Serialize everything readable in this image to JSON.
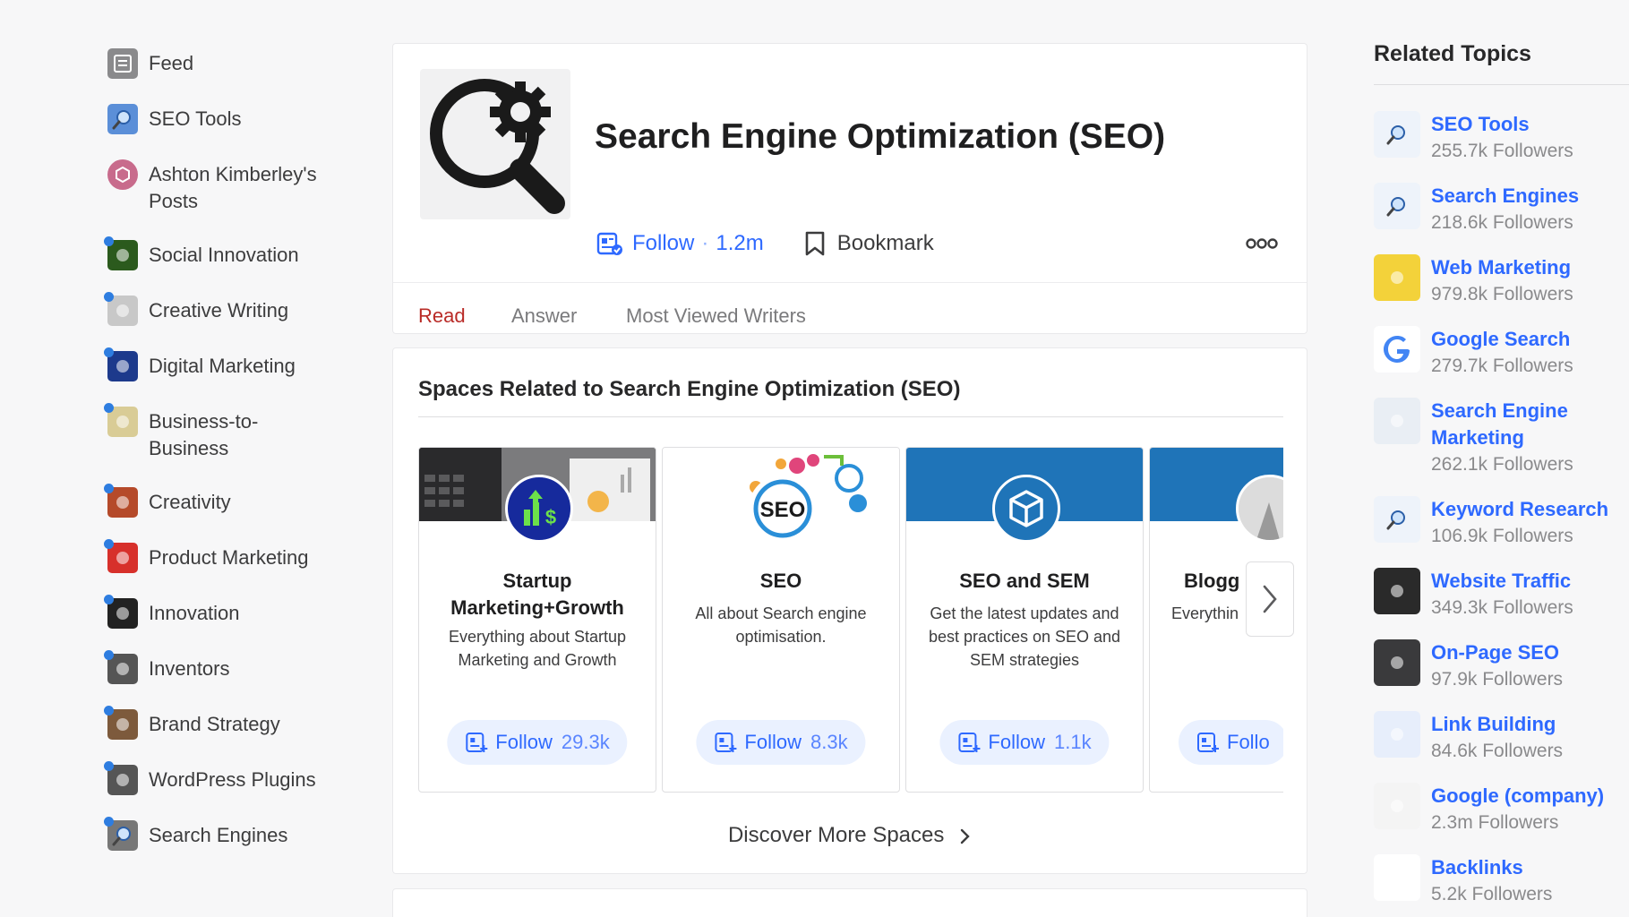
{
  "sidebar": {
    "items": [
      {
        "label": "Feed",
        "icon": "feed-icon",
        "dot": false,
        "color": "#8a8a8c"
      },
      {
        "label": "SEO Tools",
        "icon": "magnifier-icon",
        "dot": false,
        "color": "#5b8fd8"
      },
      {
        "label": "Ashton Kimberley's Posts",
        "icon": "cube-icon",
        "dot": false,
        "color": "#c86b8c"
      },
      {
        "label": "Social Innovation",
        "icon": "bulb-icon",
        "dot": true,
        "color": "#2b5a1d"
      },
      {
        "label": "Creative Writing",
        "icon": "pen-icon",
        "dot": true,
        "color": "#c8c8c8"
      },
      {
        "label": "Digital Marketing",
        "icon": "chart-icon",
        "dot": true,
        "color": "#1d3a8c"
      },
      {
        "label": "Business-to-Business",
        "icon": "handshake-icon",
        "dot": true,
        "color": "#d9cc96"
      },
      {
        "label": "Creativity",
        "icon": "palette-icon",
        "dot": true,
        "color": "#b54a2a"
      },
      {
        "label": "Product Marketing",
        "icon": "new-badge-icon",
        "dot": true,
        "color": "#d7302b"
      },
      {
        "label": "Innovation",
        "icon": "gears-icon",
        "dot": true,
        "color": "#222222"
      },
      {
        "label": "Inventors",
        "icon": "people-icon",
        "dot": true,
        "color": "#555555"
      },
      {
        "label": "Brand Strategy",
        "icon": "owl-icon",
        "dot": true,
        "color": "#7d5a3c"
      },
      {
        "label": "WordPress Plugins",
        "icon": "wordpress-icon",
        "dot": true,
        "color": "#555555"
      },
      {
        "label": "Search Engines",
        "icon": "magnifier-icon",
        "dot": true,
        "color": "#777777"
      }
    ]
  },
  "topic": {
    "title": "Search Engine Optimization (SEO)",
    "follow_label": "Follow",
    "follow_count": "1.2m",
    "bookmark_label": "Bookmark"
  },
  "tabs": [
    {
      "label": "Read",
      "active": true
    },
    {
      "label": "Answer",
      "active": false
    },
    {
      "label": "Most Viewed Writers",
      "active": false
    }
  ],
  "spaces": {
    "title": "Spaces Related to Search Engine Optimization (SEO)",
    "discover_label": "Discover More Spaces",
    "items": [
      {
        "name": "Startup Marketing+Growth",
        "desc": "Everything about Startup Marketing and Growth",
        "follow_label": "Follow",
        "follow_count": "29.3k",
        "banner": "#3a3a3c",
        "logo": "#162a9c"
      },
      {
        "name": "SEO",
        "desc": "All about Search engine optimisation.",
        "follow_label": "Follow",
        "follow_count": "8.3k",
        "banner": "#ffffff",
        "logo": "#ffffff"
      },
      {
        "name": "SEO and SEM",
        "desc": "Get the latest updates and best practices on SEO and SEM strategies",
        "follow_label": "Follow",
        "follow_count": "1.1k",
        "banner": "#1f74b8",
        "logo": "#1f74b8"
      },
      {
        "name": "Blogg",
        "desc": "Everythin",
        "follow_label": "Follo",
        "follow_count": "",
        "banner": "#1f74b8",
        "logo": "#e0e0e0"
      }
    ]
  },
  "related": {
    "title": "Related Topics",
    "items": [
      {
        "name": "SEO Tools",
        "count": "255.7k Followers",
        "icon": "magnifier-icon"
      },
      {
        "name": "Search Engines",
        "count": "218.6k Followers",
        "icon": "magnifier-icon"
      },
      {
        "name": "Web Marketing",
        "count": "979.8k Followers",
        "icon": "success-badge-icon"
      },
      {
        "name": "Google Search",
        "count": "279.7k Followers",
        "icon": "google-icon"
      },
      {
        "name": "Search Engine Marketing",
        "count": "262.1k Followers",
        "icon": "browser-search-icon"
      },
      {
        "name": "Keyword Research",
        "count": "106.9k Followers",
        "icon": "magnifier-icon"
      },
      {
        "name": "Website Traffic",
        "count": "349.3k Followers",
        "icon": "traffic-light-icon"
      },
      {
        "name": "On-Page SEO",
        "count": "97.9k Followers",
        "icon": "phone-icon"
      },
      {
        "name": "Link Building",
        "count": "84.6k Followers",
        "icon": "network-icon"
      },
      {
        "name": "Google (company)",
        "count": "2.3m Followers",
        "icon": "google-logo-icon"
      },
      {
        "name": "Backlinks",
        "count": "5.2k Followers",
        "icon": "gear-search-icon"
      }
    ]
  },
  "colors": {
    "accent_blue": "#2e69ff",
    "accent_red": "#b92b27"
  }
}
